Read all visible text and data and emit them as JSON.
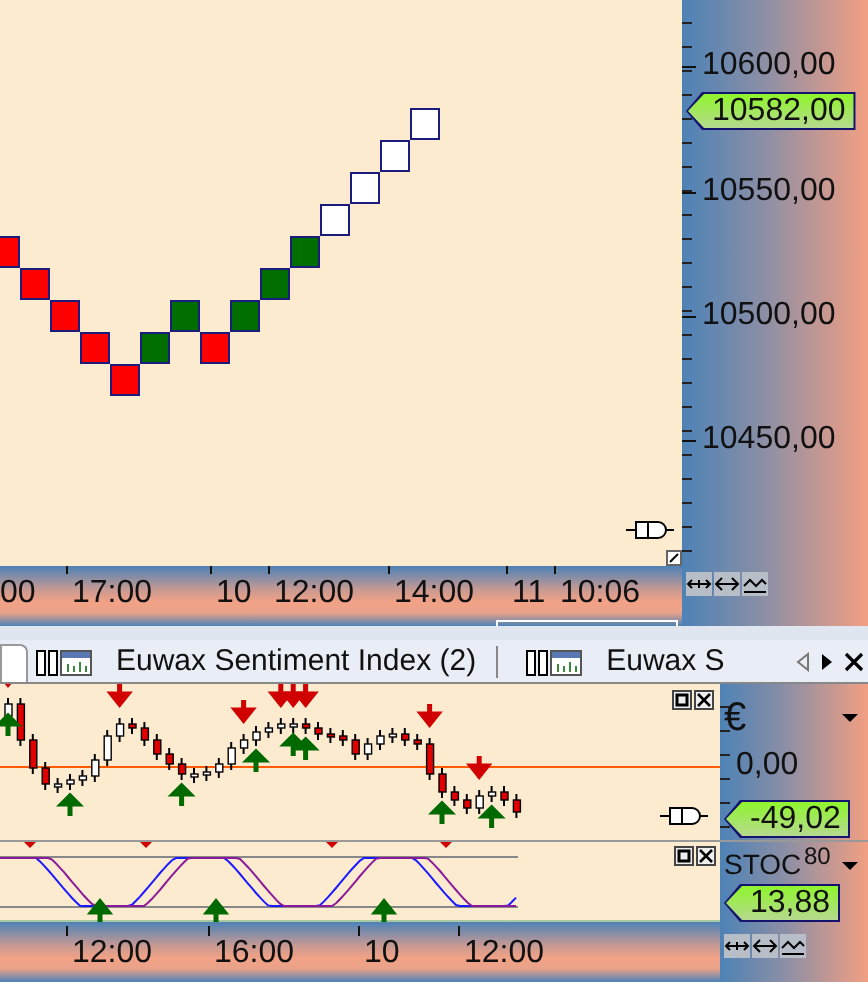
{
  "main_chart": {
    "bricks": [
      {
        "kind": "down"
      },
      {
        "kind": "down"
      },
      {
        "kind": "down"
      },
      {
        "kind": "down"
      },
      {
        "kind": "down"
      },
      {
        "kind": "up"
      },
      {
        "kind": "up"
      },
      {
        "kind": "down"
      },
      {
        "kind": "up"
      },
      {
        "kind": "up"
      },
      {
        "kind": "up"
      },
      {
        "kind": "hollow"
      },
      {
        "kind": "hollow"
      },
      {
        "kind": "hollow"
      },
      {
        "kind": "hollow"
      }
    ],
    "price_axis": {
      "labels": [
        "10600,00",
        "10550,00",
        "10500,00",
        "10450,00"
      ],
      "last_price": "10582,00"
    }
  },
  "time_axis": {
    "labels": [
      "00",
      "17:00",
      "10",
      "12:00",
      "14:00",
      "11",
      "10:06"
    ]
  },
  "tabs": [
    {
      "label": "Euwax Sentiment Index (2)",
      "selected": false
    },
    {
      "label": "Euwax S",
      "selected": false
    }
  ],
  "indicator_panel": {
    "currency": "€",
    "zero_label": "0,00",
    "value": "-49,02"
  },
  "oscillator_panel": {
    "name": "STOC",
    "level_label": "80",
    "value": "13,88"
  },
  "bottom_axis": {
    "labels": [
      "12:00",
      "16:00",
      "10",
      "12:00"
    ]
  }
}
